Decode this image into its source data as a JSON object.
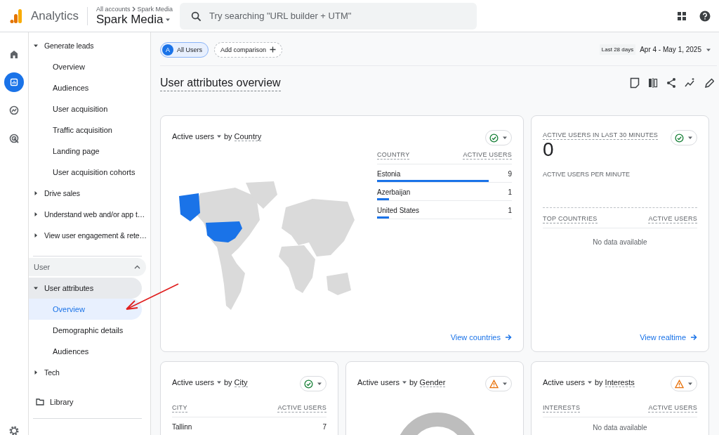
{
  "header": {
    "product": "Analytics",
    "breadcrumb": [
      "All accounts",
      "Spark Media"
    ],
    "property": "Spark Media",
    "search": {
      "placeholder": "Try searching \"URL builder + UTM\""
    }
  },
  "rail": [
    {
      "kind": "home",
      "selected": false
    },
    {
      "kind": "reports",
      "selected": true
    },
    {
      "kind": "explore",
      "selected": false
    },
    {
      "kind": "advertising",
      "selected": false
    }
  ],
  "sidebar": {
    "items": [
      {
        "label": "Generate leads",
        "expanded": true,
        "children": [
          {
            "label": "Overview",
            "selected": false
          },
          {
            "label": "Audiences",
            "selected": false
          },
          {
            "label": "User acquisition",
            "selected": false
          },
          {
            "label": "Traffic acquisition",
            "selected": false
          },
          {
            "label": "Landing page",
            "selected": false
          },
          {
            "label": "User acquisition cohorts",
            "selected": false
          }
        ]
      },
      {
        "label": "Drive sales",
        "expanded": false
      },
      {
        "label": "Understand web and/or app t…",
        "expanded": false
      },
      {
        "label": "View user engagement & rete…",
        "expanded": false
      }
    ],
    "section": {
      "label": "User",
      "expanded": true,
      "items": [
        {
          "label": "User attributes",
          "expanded": true,
          "children": [
            {
              "label": "Overview",
              "selected": true
            },
            {
              "label": "Demographic details",
              "selected": false
            },
            {
              "label": "Audiences",
              "selected": false
            }
          ]
        },
        {
          "label": "Tech",
          "expanded": false
        }
      ]
    },
    "library": "Library"
  },
  "comparisons": [
    {
      "kind": "segment",
      "badge": "A",
      "label": "All Users"
    },
    {
      "kind": "add",
      "label": "Add comparison"
    }
  ],
  "date_range": {
    "preset": "Last 28 days",
    "range": "Apr 4 - May 1, 2025"
  },
  "page_title": "User attributes overview",
  "cards": [
    {
      "kind": "map_table",
      "metric": "Active users",
      "by": "by",
      "dimension": "Country",
      "warning": false,
      "columns": [
        "COUNTRY",
        "ACTIVE USERS"
      ],
      "rows": [
        {
          "name": "Estonia",
          "value": "9",
          "level": 0.83
        },
        {
          "name": "Azerbaijan",
          "value": "1",
          "level": 0.09
        },
        {
          "name": "United States",
          "value": "1",
          "level": 0.09
        }
      ],
      "link": "View countries"
    },
    {
      "kind": "realtime",
      "title": "ACTIVE USERS IN LAST 30 MINUTES",
      "value": "0",
      "subtitle": "ACTIVE USERS PER MINUTE",
      "warning": false,
      "columns": [
        "TOP COUNTRIES",
        "ACTIVE USERS"
      ],
      "empty": "No data available",
      "link": "View realtime"
    },
    {
      "kind": "table",
      "metric": "Active users",
      "by": "by",
      "dimension": "City",
      "warning": false,
      "columns": [
        "CITY",
        "ACTIVE USERS"
      ],
      "rows": [
        {
          "name": "Tallinn",
          "value": "7"
        }
      ]
    },
    {
      "kind": "donut",
      "metric": "Active users",
      "by": "by",
      "dimension": "Gender",
      "warning": true
    },
    {
      "kind": "table",
      "metric": "Active users",
      "by": "by",
      "dimension": "Interests",
      "warning": true,
      "columns": [
        "INTERESTS",
        "ACTIVE USERS"
      ],
      "empty": "No data available"
    }
  ]
}
